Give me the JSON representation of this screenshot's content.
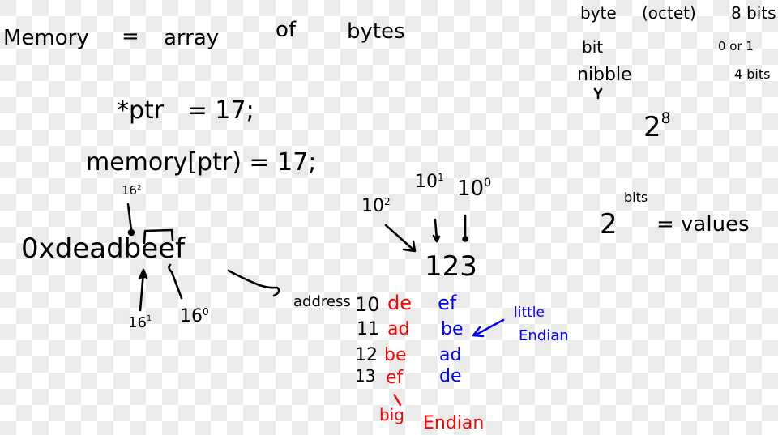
{
  "colors": {
    "ink": "#000000",
    "big_endian": "#ff0000",
    "little_endian": "#0000ff"
  },
  "header": {
    "memory_label": "Memory",
    "equals": "=",
    "array": "array",
    "of": "of",
    "bytes": "bytes"
  },
  "definitions": [
    {
      "term": "byte",
      "alias": "(octet)",
      "value": "8 bits"
    },
    {
      "term": "bit",
      "alias": "",
      "value": "0 or 1"
    },
    {
      "term": "nibble",
      "alias": "",
      "value": "4 bits"
    }
  ],
  "powers": {
    "two_eight_base": "2",
    "two_eight_exp": "8",
    "two_bits_base": "2",
    "two_bits_exp": "bits",
    "two_bits_rhs": "= values"
  },
  "code": {
    "deref": "*ptr   = 17;",
    "index": "memory[ptr) = 17;"
  },
  "hex": {
    "value": "0xdeadbeef",
    "prefix": "0xdeadb",
    "e1": "e",
    "e2": "e",
    "f": "f",
    "pow2": "16",
    "pow2_exp": "2",
    "pow1": "16",
    "pow1_exp": "1",
    "pow0": "16",
    "pow0_exp": "0"
  },
  "decimal": {
    "number": "123",
    "pow2": "10",
    "pow2_exp": "2",
    "pow1": "10",
    "pow1_exp": "1",
    "pow0": "10",
    "pow0_exp": "0"
  },
  "table": {
    "address_label": "address",
    "rows": [
      {
        "address": "10",
        "big": "de",
        "little": "ef"
      },
      {
        "address": "11",
        "big": "ad",
        "little": "be"
      },
      {
        "address": "12",
        "big": "be",
        "little": "ad"
      },
      {
        "address": "13",
        "big": "ef",
        "little": "de"
      }
    ],
    "big_label_1": "big",
    "big_label_2": "Endian",
    "little_label_1": "little",
    "little_label_2": "Endian"
  }
}
